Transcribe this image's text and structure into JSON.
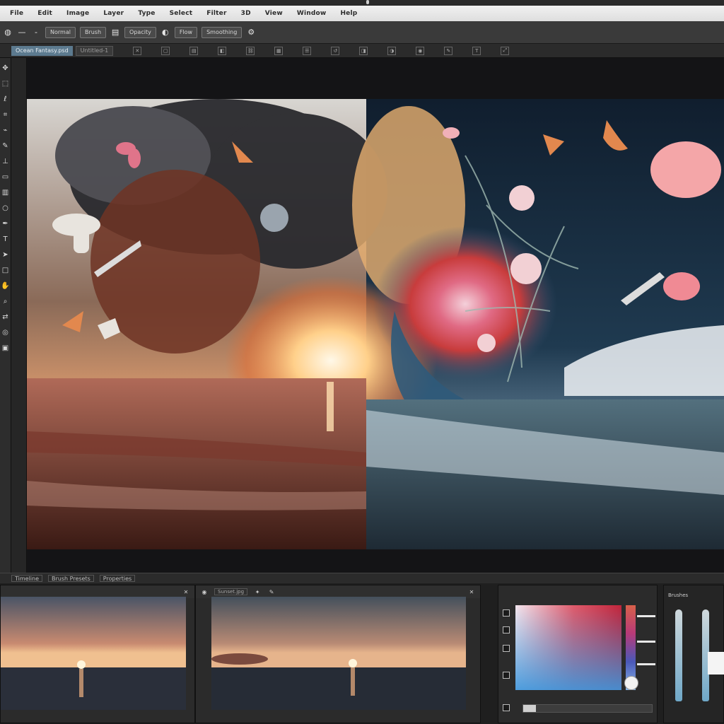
{
  "menu": [
    "File",
    "Edit",
    "Image",
    "Layer",
    "Type",
    "Select",
    "Filter",
    "3D",
    "View",
    "Window",
    "Help"
  ],
  "options": {
    "mode_label": "Normal",
    "brush_label": "Brush",
    "opacity_label": "Opacity",
    "flow_label": "Flow",
    "smooth_label": "Smoothing"
  },
  "tabs": {
    "active": "Ocean Fantasy.psd",
    "inactive": "Untitled-1"
  },
  "bottom_labels": [
    "Timeline",
    "Brush Presets",
    "Properties"
  ],
  "thumbs": {
    "second_title": "Sunset.jpg"
  },
  "brushes": {
    "title": "Brushes"
  },
  "colors": {
    "accent": "#5c7a8f",
    "menu_bg": "#e6e6e6"
  },
  "opacity_level": 0.1,
  "icons": [
    "move-icon",
    "marquee-icon",
    "lasso-icon",
    "crop-icon",
    "eyedropper-icon",
    "brush-icon",
    "stamp-icon",
    "eraser-icon",
    "gradient-icon",
    "dodge-icon",
    "pen-icon",
    "type-icon",
    "path-icon",
    "shape-icon",
    "hand-icon",
    "zoom-icon"
  ]
}
